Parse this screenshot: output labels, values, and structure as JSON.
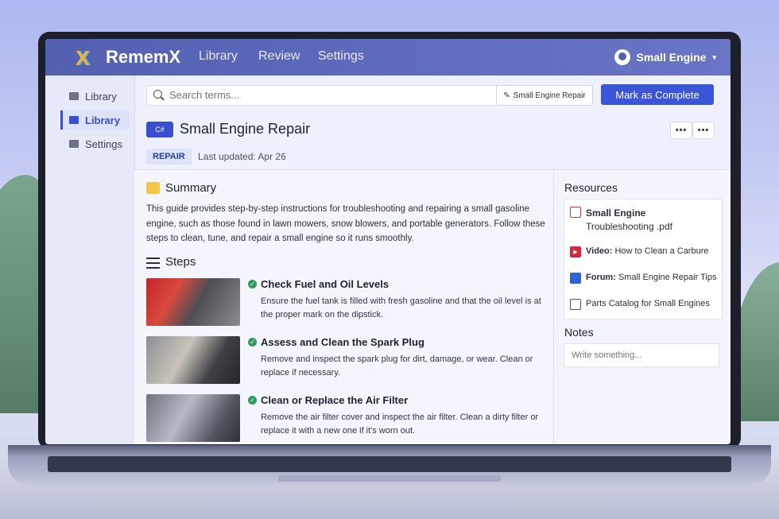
{
  "app": {
    "name": "RememX"
  },
  "nav": {
    "items": [
      "Library",
      "Review",
      "Settings"
    ]
  },
  "user": {
    "name": "Small Engine"
  },
  "sidebar": {
    "items": [
      {
        "label": "Library",
        "active": false
      },
      {
        "label": "Library",
        "active": true
      },
      {
        "label": "Settings",
        "active": false
      }
    ]
  },
  "search": {
    "placeholder": "Search terms..."
  },
  "chip": {
    "label": "Small Engine Repair"
  },
  "actions": {
    "complete_label": "Mark as Complete",
    "more": "•••"
  },
  "page": {
    "icon_text": "C#",
    "title": "Small Engine Repair",
    "tag": "REPAIR",
    "updated": "Last updated: Apr 26"
  },
  "summary": {
    "title": "Summary",
    "text": "This guide provides step-by-step instructions for troubleshooting and repairing a small gasoline engine, such as those found in lawn mowers, snow blowers, and portable generators. Follow these steps to clean, tune, and repair a small engine so it runs smoothly."
  },
  "steps": {
    "title": "Steps",
    "items": [
      {
        "title": "Check Fuel and Oil Levels",
        "desc": "Ensure the fuel tank is filled with fresh gasoline and that the oil level is at the proper mark on the dipstick."
      },
      {
        "title": "Assess and Clean the Spark Plug",
        "desc": "Remove and inspect the spark plug for dirt, damage, or wear. Clean or replace if necessary."
      },
      {
        "title": "Clean or Replace the Air Filter",
        "desc": "Remove the air filter cover and inspect the air filter. Clean a dirty filter or replace it with a new one if it's worn out."
      }
    ]
  },
  "resources": {
    "title": "Resources",
    "items": [
      {
        "prefix": "Small Engine",
        "text": "Troubleshooting .pdf",
        "icon": "pdf-icon"
      },
      {
        "prefix": "Video:",
        "text": "How to Clean a Carbure",
        "icon": "video-icon"
      },
      {
        "prefix": "Forum:",
        "text": "Small Engine Repair Tips",
        "icon": "forum-icon"
      },
      {
        "prefix": "",
        "text": "Parts Catalog for Small Engines",
        "icon": "catalog-icon"
      }
    ]
  },
  "notes": {
    "title": "Notes",
    "placeholder": "Write something..."
  },
  "colors": {
    "accent": "#3a55d8",
    "topbar": "#5360b0",
    "check": "#2f9a5a"
  }
}
